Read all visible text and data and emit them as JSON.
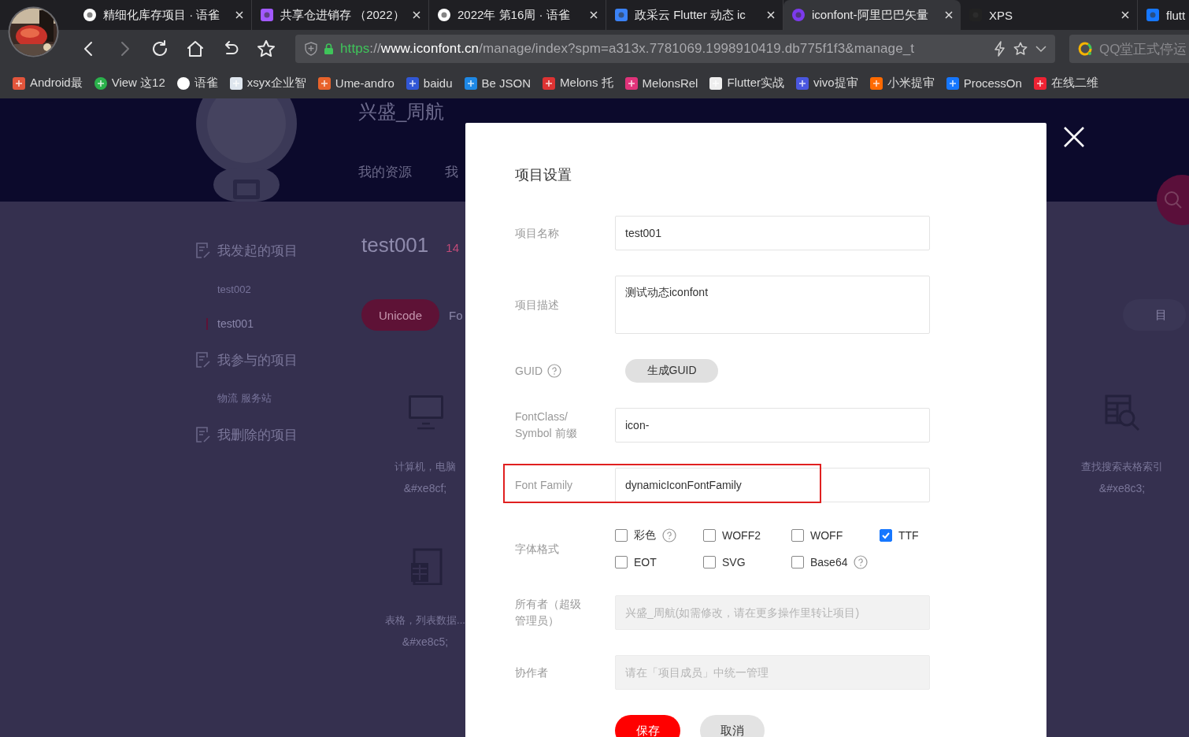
{
  "browser": {
    "tabs": [
      {
        "title": "精细化库存项目 · 语雀",
        "selected": false
      },
      {
        "title": "共享仓进销存 （2022）",
        "selected": false
      },
      {
        "title": "2022年 第16周 · 语雀",
        "selected": false
      },
      {
        "title": "政采云 Flutter 动态 ic",
        "selected": false
      },
      {
        "title": "iconfont-阿里巴巴矢量",
        "selected": true
      },
      {
        "title": "XPS",
        "selected": false
      },
      {
        "title": "flutt",
        "selected": false
      }
    ],
    "url_parts": [
      {
        "kind": "scheme",
        "text": "https"
      },
      {
        "kind": "rest",
        "text": "://"
      },
      {
        "kind": "host",
        "text": "www.iconfont.cn"
      },
      {
        "kind": "rest",
        "text": "/manage/index?spm=a313x.7781069.1998910419.db775f1f3&manage_t"
      }
    ],
    "search_placeholder": "QQ堂正式停运",
    "bookmarks": [
      "Android最",
      "View 这12",
      "语雀",
      "xsyx企业智",
      "Ume-andro",
      "baidu",
      "Be JSON",
      "Melons 托",
      "MelonsRel",
      "Flutter实战",
      "vivo提审",
      "小米提审",
      "ProcessOn",
      "在线二维"
    ]
  },
  "page": {
    "logo": "兴盛_周航",
    "nav": [
      "我的资源",
      "我"
    ],
    "sidebar": [
      {
        "title": "我发起的项目",
        "children": [
          {
            "label": "test002",
            "selected": false
          },
          {
            "label": "test001",
            "selected": true
          }
        ]
      },
      {
        "title": "我参与的项目",
        "children": [
          {
            "label": "物流 服务站",
            "selected": false
          }
        ]
      },
      {
        "title": "我删除的项目"
      }
    ],
    "project": {
      "name": "test001",
      "count": "14"
    },
    "tabs": [
      {
        "label": "Unicode",
        "selected": true
      },
      {
        "label": "Fo",
        "selected": false
      },
      {
        "label": "目",
        "selected": false
      }
    ],
    "icon_rows": [
      {
        "left": {
          "label": "计算机，电脑",
          "code": "&#xe8cf;"
        },
        "right": {
          "label": "查找搜索表格索引",
          "code": "&#xe8c3;"
        }
      },
      {
        "left": {
          "label": "表格，列表数据...",
          "code": "&#xe8c5;"
        }
      }
    ]
  },
  "dialog": {
    "title": "项目设置",
    "fields": [
      {
        "kind": "input",
        "label": "项目名称",
        "value": "test001",
        "help": false,
        "highlighted": false,
        "disabled": false
      },
      {
        "kind": "textarea",
        "label": "项目描述",
        "value": "测试动态iconfont",
        "help": false,
        "highlighted": false
      },
      {
        "kind": "button",
        "label": "GUID",
        "button": "生成GUID",
        "help": true,
        "highlighted": false
      },
      {
        "kind": "input",
        "label": "FontClass/ Symbol 前缀",
        "value": "icon-",
        "help": false,
        "highlighted": false,
        "disabled": false
      },
      {
        "kind": "input",
        "label": "Font Family",
        "value": "dynamicIconFontFamily",
        "help": false,
        "highlighted": true,
        "disabled": false
      },
      {
        "kind": "checkboxes",
        "label": "字体格式",
        "help": false,
        "highlighted": false,
        "options": [
          {
            "label": "彩色",
            "checked": false,
            "help": true
          },
          {
            "label": "WOFF2",
            "checked": false,
            "help": false
          },
          {
            "label": "WOFF",
            "checked": false,
            "help": false
          },
          {
            "label": "TTF",
            "checked": true,
            "help": false
          },
          {
            "label": "EOT",
            "checked": false,
            "help": false
          },
          {
            "label": "SVG",
            "checked": false,
            "help": false
          },
          {
            "label": "Base64",
            "checked": false,
            "help": true
          }
        ]
      },
      {
        "kind": "input",
        "label": "所有者（超级管理员）",
        "placeholder": "兴盛_周航(如需修改，请在更多操作里转让项目)",
        "help": false,
        "highlighted": false,
        "disabled": true
      },
      {
        "kind": "input",
        "label": "协作者",
        "placeholder": "请在「项目成员」中统一管理",
        "help": false,
        "highlighted": false,
        "disabled": true
      }
    ],
    "buttons": [
      {
        "label": "保存",
        "kind": "primary"
      },
      {
        "label": "取消",
        "kind": "secondary"
      }
    ]
  }
}
